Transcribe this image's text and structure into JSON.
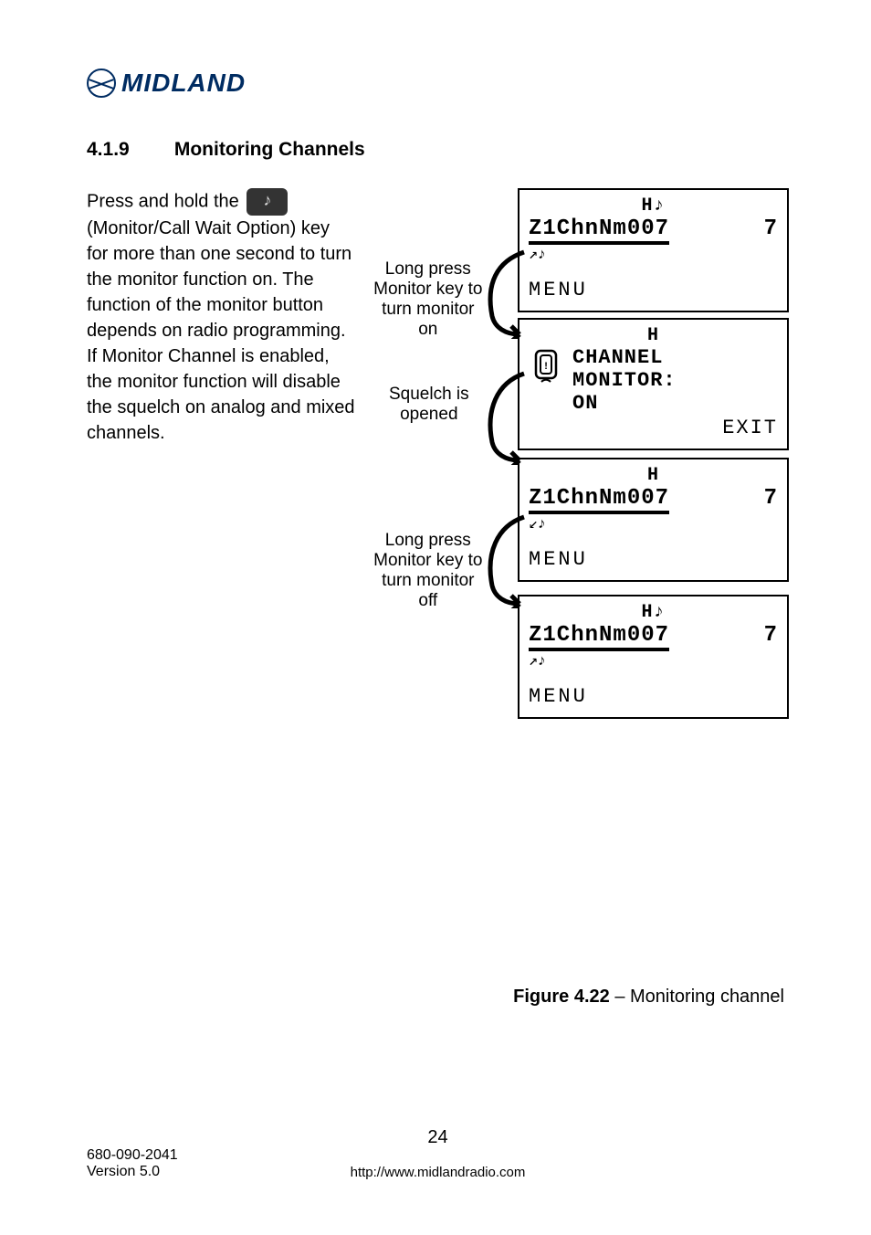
{
  "logo": {
    "text": "MIDLAND"
  },
  "section": {
    "number": "4.1.9",
    "title": "Monitoring Channels"
  },
  "body": {
    "intro_before_icon": "Press and hold the ",
    "intro_after_icon": "(Monitor/Call Wait Option) key for more than one second to turn the monitor function on. The function of the monitor button depends on radio programming. If Monitor Channel is enabled, the monitor function will disable the squelch on analog and mixed channels."
  },
  "labels": {
    "label1": "Long press Monitor key to turn monitor on",
    "label2": "Squelch is opened",
    "label3": "Long press Monitor key to turn monitor off"
  },
  "screens": {
    "s1": {
      "header": "H♪",
      "ch": "Z1ChnNm007",
      "num": "7",
      "icons": "↗♪",
      "menu": "MENU"
    },
    "s2": {
      "header": "H",
      "l1": "CHANNEL",
      "l2": "MONITOR:",
      "l3": "ON",
      "exit": "EXIT"
    },
    "s3": {
      "header": "H",
      "ch": "Z1ChnNm007",
      "num": "7",
      "icons": "↙♪",
      "menu": "MENU"
    },
    "s4": {
      "header": "H♪",
      "ch": "Z1ChnNm007",
      "num": "7",
      "icons": "↗♪",
      "menu": "MENU"
    }
  },
  "figure": {
    "bold": "Figure 4.22",
    "rest": " – Monitoring channel"
  },
  "footer": {
    "doc": "680-090-2041",
    "version": "Version 5.0",
    "page": "24",
    "url": "http://www.midlandradio.com"
  }
}
